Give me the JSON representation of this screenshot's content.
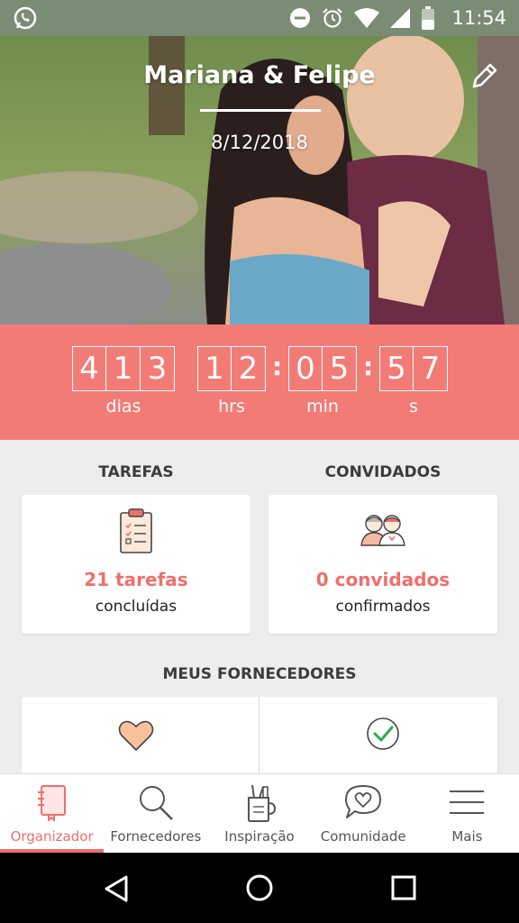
{
  "status_bar": {
    "time": "11:54",
    "icons": [
      "whatsapp-icon",
      "do-not-disturb-icon",
      "alarm-icon",
      "wifi-icon",
      "signal-icon",
      "battery-icon"
    ]
  },
  "hero": {
    "couple_names": "Mariana & Felipe",
    "wedding_date": "8/12/2018",
    "edit_icon": "pencil-icon"
  },
  "countdown": {
    "days": [
      "4",
      "1",
      "3"
    ],
    "hours": [
      "1",
      "2"
    ],
    "minutes": [
      "0",
      "5"
    ],
    "seconds": [
      "5",
      "7"
    ],
    "separator": ":",
    "labels": {
      "days": "dias",
      "hours": "hrs",
      "minutes": "min",
      "seconds": "s"
    }
  },
  "tasks": {
    "title": "TAREFAS",
    "count": "21 tarefas",
    "subtitle": "concluídas",
    "icon": "clipboard-checklist-icon"
  },
  "guests": {
    "title": "CONVIDADOS",
    "count": "0 convidados",
    "subtitle": "confirmados",
    "icon": "couple-guests-icon"
  },
  "vendors": {
    "title": "MEUS FORNECEDORES",
    "icons": [
      "heart-icon",
      "check-circle-icon"
    ]
  },
  "bottom_nav": {
    "items": [
      {
        "label": "Organizador",
        "icon": "notebook-icon",
        "active": true
      },
      {
        "label": "Fornecedores",
        "icon": "search-icon",
        "active": false
      },
      {
        "label": "Inspiração",
        "icon": "pencil-cup-icon",
        "active": false
      },
      {
        "label": "Comunidade",
        "icon": "chat-heart-icon",
        "active": false
      },
      {
        "label": "Mais",
        "icon": "menu-icon",
        "active": false
      }
    ]
  },
  "colors": {
    "accent": "#f37b76",
    "accent_text": "#ee6f6c",
    "background": "#ededed",
    "status_bar": "#7a8d74"
  }
}
